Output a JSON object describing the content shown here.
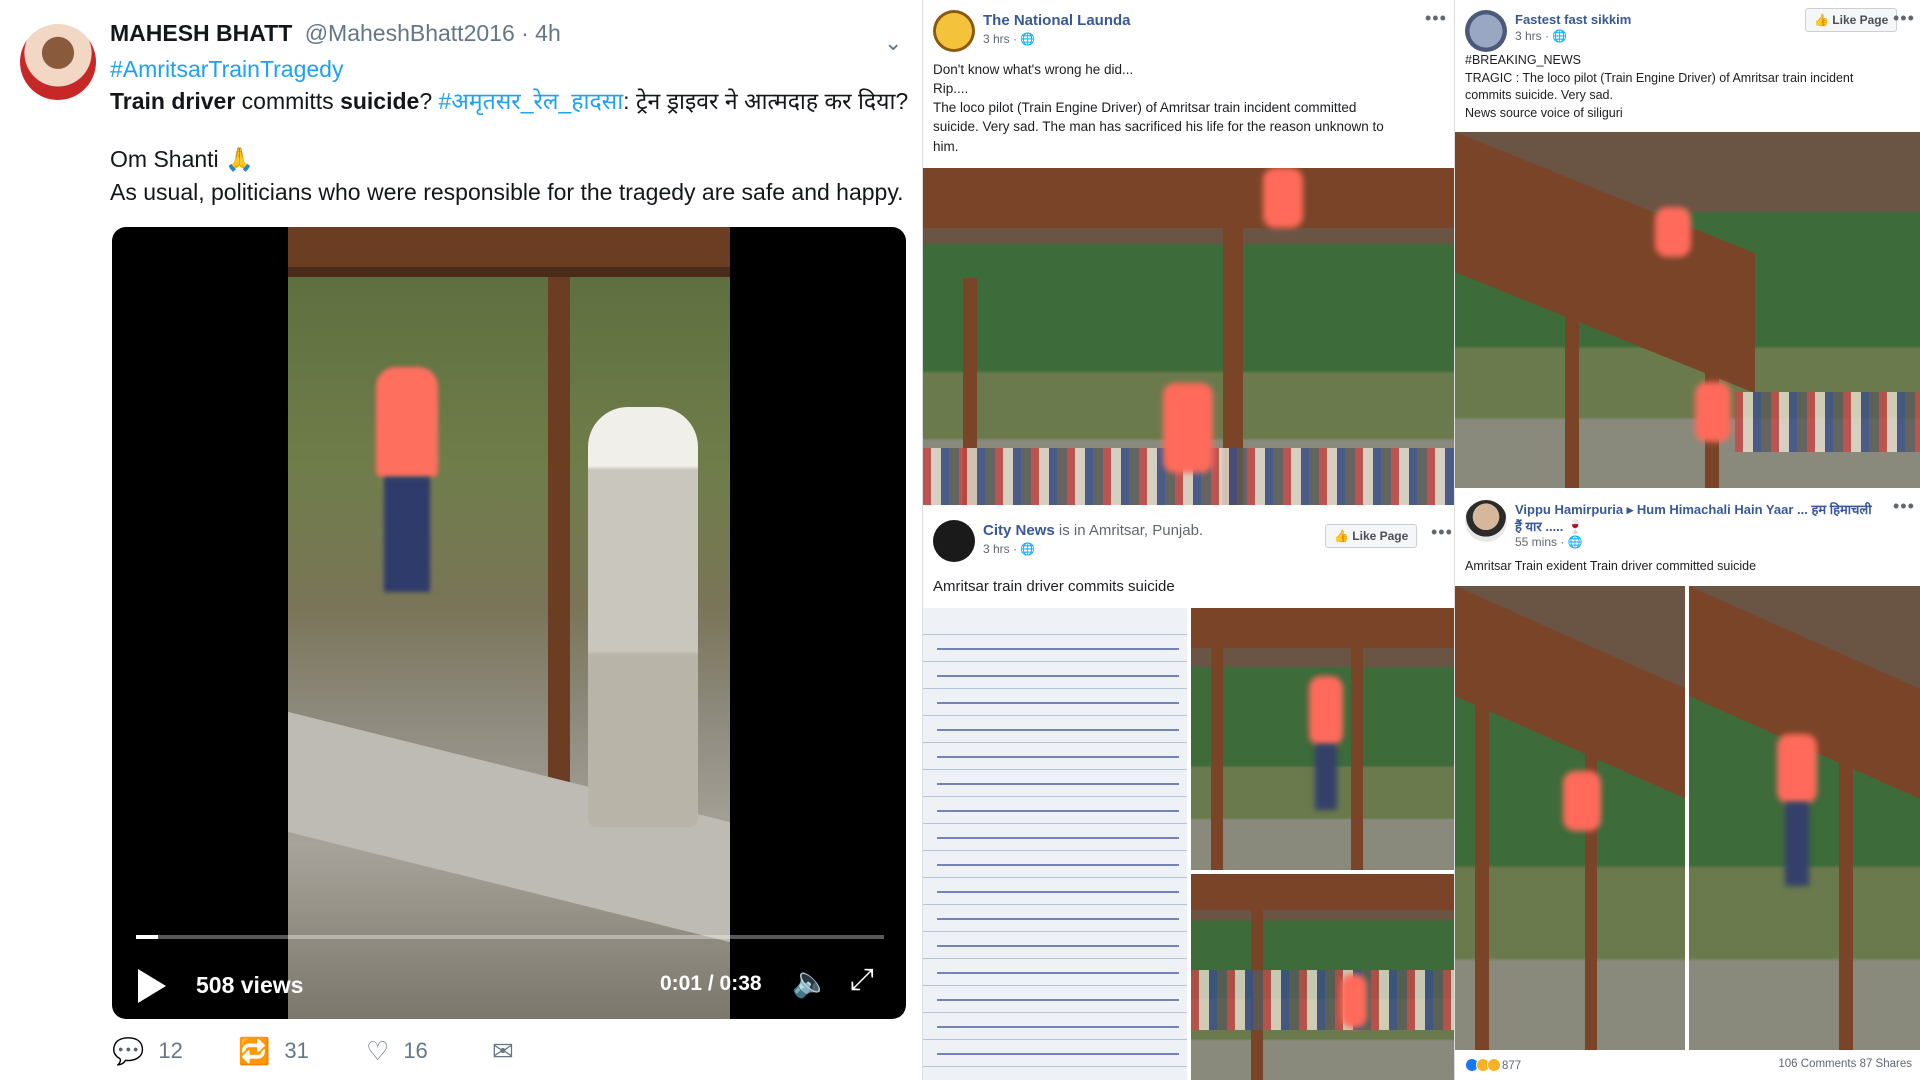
{
  "tweet": {
    "author_name": "MAHESH BHATT",
    "handle": "@MaheshBhatt2016 · 4h",
    "hashtag": "#AmritsarTrainTragedy",
    "line2_part1": "Train driver",
    "line2_part2": " committs ",
    "line2_part3": "suicide",
    "line2_part4": "? ",
    "line2_hashtag_hindi": "#अमृतसर_रेल_हादसा",
    "line2_part5": ": ट्रेन ड्राइवर ने आत्मदाह कर दिया?",
    "line3": "Om Shanti 🙏",
    "line4": "As usual, politicians who were responsible for the tragedy are safe and happy.",
    "video": {
      "views": "508 views",
      "time": "0:01 / 0:38",
      "progress": 0.03
    },
    "actions": {
      "replies": "12",
      "retweets": "31",
      "likes": "16"
    }
  },
  "fb_national_launda": {
    "page_name": "The National Launda",
    "time": "3 hrs · 🌐",
    "text_lines": [
      "Don't know what's wrong he did...",
      "Rip....",
      "The loco pilot (Train Engine Driver) of Amritsar train incident committed",
      "suicide. Very sad. The man has sacrificed his life for the reason unknown to",
      "him."
    ]
  },
  "fb_city_news": {
    "page_name": "City News",
    "location_text": " is in Amritsar, Punjab.",
    "time": "3 hrs · 🌐",
    "like_page": "Like Page",
    "text": "Amritsar train driver commits suicide"
  },
  "fb_fastest_sikkim": {
    "page_name": "Fastest fast sikkim",
    "time": "3 hrs · 🌐",
    "like_page": "Like Page",
    "text_lines": [
      "#BREAKING_NEWS",
      "TRAGIC : The loco pilot (Train Engine Driver) of Amritsar train incident",
      "commits suicide. Very sad.",
      "News source voice of siliguri"
    ]
  },
  "fb_vippu": {
    "page_name": "Vippu Hamirpuria ▸ Hum Himachali Hain Yaar ... हम हिमाचली",
    "page_name_line2": "हैं यार ..... 🍷",
    "time": "55 mins · 🌐",
    "text": "Amritsar Train exident Train driver committed suicide",
    "reactions": "877",
    "comments_shares": "106 Comments  87 Shares"
  },
  "colors": {
    "twitter_blue": "#1da1f2",
    "twitter_gray": "#657786",
    "facebook_link": "#385898"
  }
}
